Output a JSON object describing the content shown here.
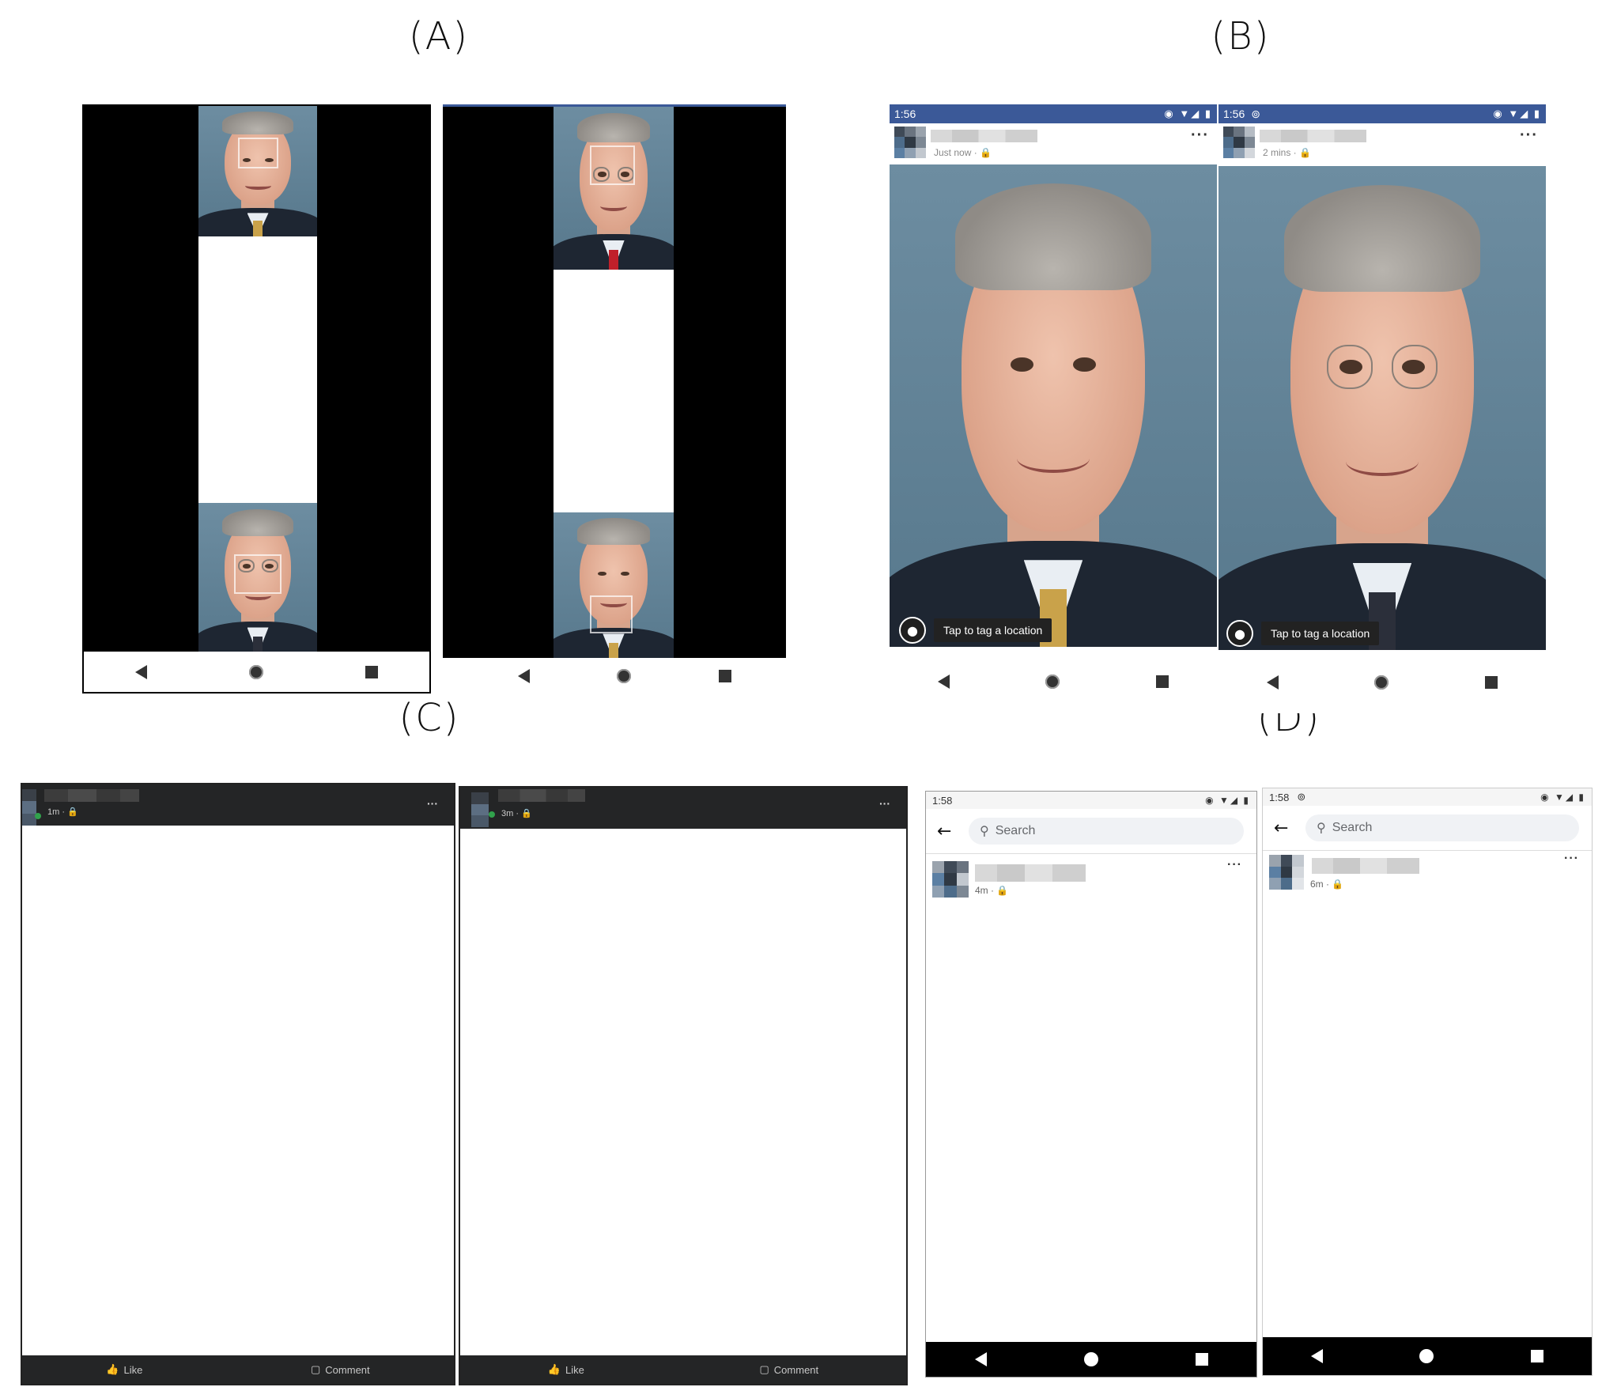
{
  "labels": {
    "a": "(A)",
    "b": "(B)",
    "c": "(C)",
    "d": "(D)"
  },
  "panel_b": {
    "left": {
      "time": "1:56",
      "meta": "Just now ·",
      "tag_label": "Tap to tag a location"
    },
    "right": {
      "time": "1:56",
      "meta": "2 mins ·",
      "tag_label": "Tap to tag a location"
    }
  },
  "panel_c": {
    "left": {
      "meta": "1m ·",
      "like": "Like",
      "comment": "Comment"
    },
    "right": {
      "meta": "3m ·",
      "like": "Like",
      "comment": "Comment"
    }
  },
  "panel_d": {
    "left": {
      "time": "1:58",
      "search_placeholder": "Search",
      "meta": "4m ·"
    },
    "right": {
      "time": "1:58",
      "search_placeholder": "Search",
      "meta": "6m ·"
    }
  },
  "icons": {
    "status": "eye-wifi-signal-battery-icons",
    "more": "more-dots-icon",
    "pin": "location-pin-icon",
    "like": "thumbs-up-icon",
    "comment": "comment-bubble-icon",
    "back": "arrow-left-icon",
    "search": "magnifier-icon"
  },
  "colors": {
    "fb_blue": "#3b5998",
    "dark_bar": "#242526",
    "portrait_bg": "#5d7e93",
    "online_green": "#31a24c"
  }
}
